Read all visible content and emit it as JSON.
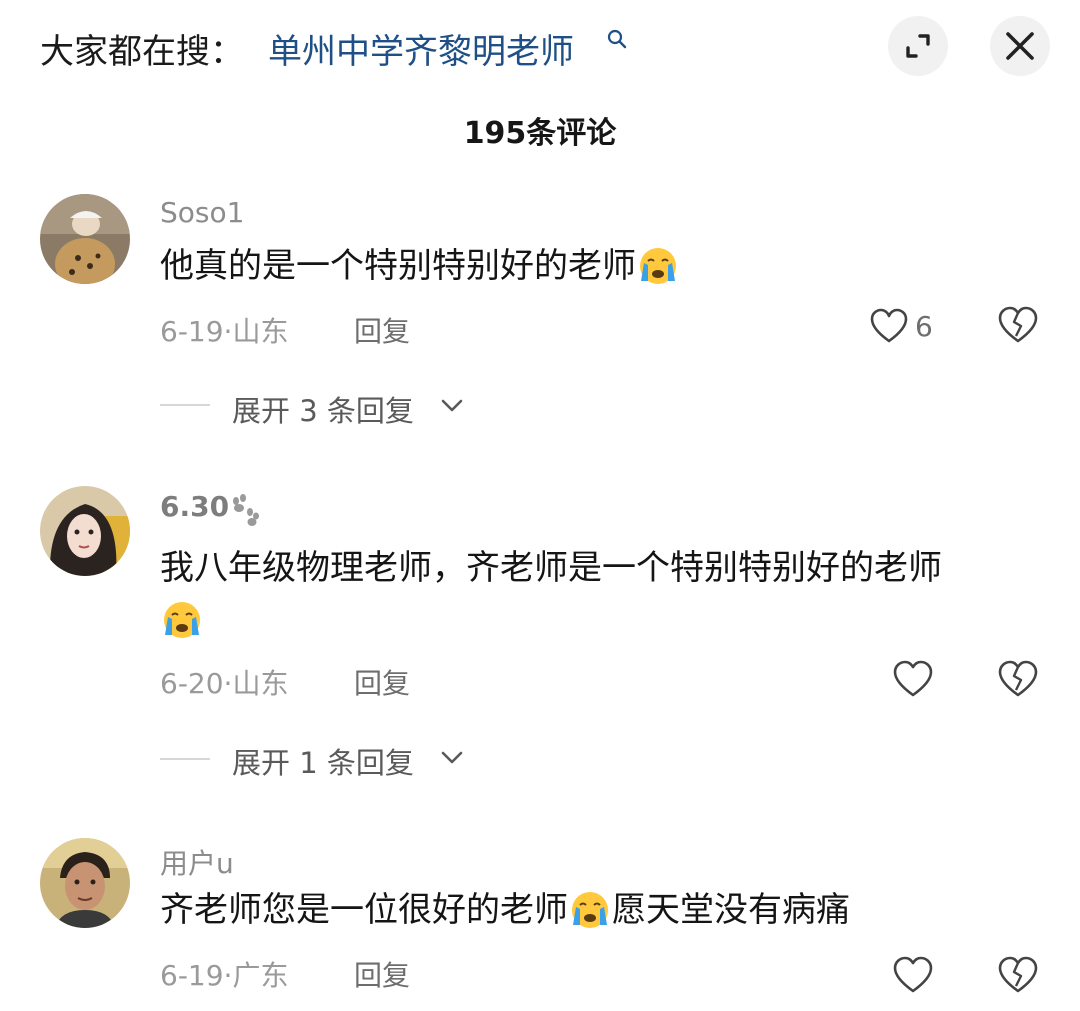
{
  "header": {
    "search_prefix": "大家都在搜：",
    "search_term": "单州中学齐黎明老师",
    "comment_count": "195条评论"
  },
  "comments": [
    {
      "username": "Soso1",
      "text": "他真的是一个特别特别好的老师",
      "date_location": "6-19·山东",
      "reply_label": "回复",
      "likes": "6",
      "expand_label": "展开 3 条回复"
    },
    {
      "username": "6.30",
      "text": "我八年级物理老师，齐老师是一个特别特别好的老师",
      "date_location": "6-20·山东",
      "reply_label": "回复",
      "expand_label": "展开 1 条回复"
    },
    {
      "username": "用户u",
      "text_part1": "齐老师您是一位很好的老师",
      "text_part2": "愿天堂没有病痛",
      "date_location": "6-19·广东",
      "reply_label": "回复"
    }
  ],
  "icons": {
    "emoji": "loudly-crying-face",
    "expand": "expand-icon",
    "close": "close-icon",
    "search": "search-icon",
    "like": "heart-icon",
    "dislike": "broken-heart-icon"
  },
  "colors": {
    "search_term": "#1e4f86",
    "emoji_face": "#ffc83d",
    "tears": "#3aa0e8"
  }
}
